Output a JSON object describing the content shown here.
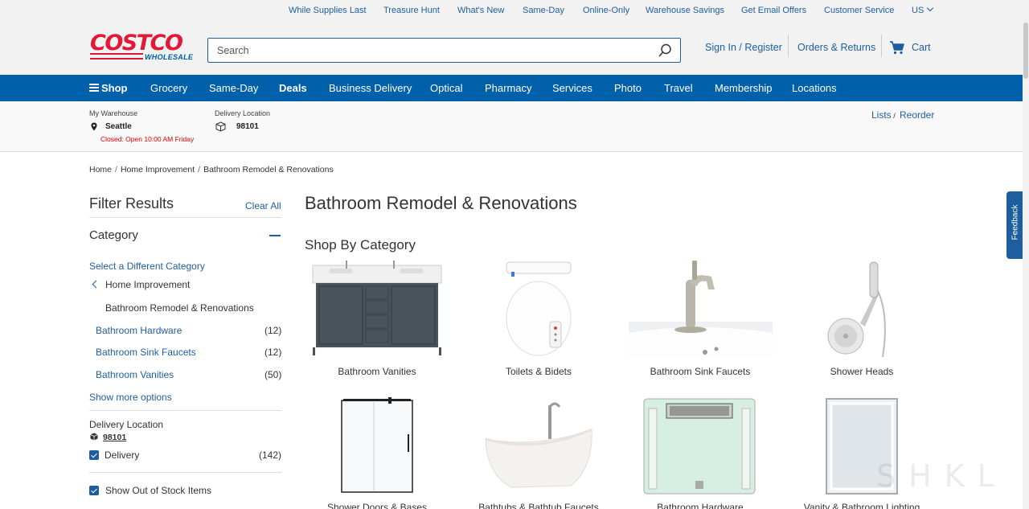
{
  "utility_bar": {
    "links": [
      "While Supplies Last",
      "Treasure Hunt",
      "What's New",
      "Same-Day",
      "Online-Only",
      "Warehouse Savings",
      "Get Email Offers",
      "Customer Service"
    ],
    "country": "US"
  },
  "header": {
    "logo_top": "COSTCO",
    "logo_bottom": "WHOLESALE",
    "search_placeholder": "Search",
    "sign_in": "Sign In / Register",
    "orders": "Orders & Returns",
    "cart": "Cart"
  },
  "nav": {
    "shop": "Shop",
    "items": [
      "Grocery",
      "Same-Day",
      "Deals",
      "Business Delivery",
      "Optical",
      "Pharmacy",
      "Services",
      "Photo",
      "Travel",
      "Membership",
      "Locations"
    ]
  },
  "location_bar": {
    "warehouse_label": "My Warehouse",
    "warehouse_name": "Seattle",
    "warehouse_status": "Closed: Open 10:00 AM Friday",
    "delivery_label": "Delivery Location",
    "delivery_zip": "98101",
    "lists": "Lists",
    "reorder": "Reorder"
  },
  "breadcrumb": [
    "Home",
    "Home Improvement",
    "Bathroom Remodel & Renovations"
  ],
  "filters": {
    "title": "Filter Results",
    "clear_all": "Clear All",
    "category_title": "Category",
    "select_different": "Select a Different Category",
    "parent": "Home Improvement",
    "current": "Bathroom Remodel & Renovations",
    "subcategories": [
      {
        "label": "Bathroom Hardware",
        "count": "(12)"
      },
      {
        "label": "Bathroom Sink Faucets",
        "count": "(12)"
      },
      {
        "label": "Bathroom Vanities",
        "count": "(50)"
      }
    ],
    "show_more": "Show more options",
    "delivery_location_label": "Delivery Location",
    "delivery_zip": "98101",
    "delivery_option": "Delivery",
    "delivery_count": "(142)",
    "show_out_of_stock": "Show Out of Stock Items"
  },
  "main": {
    "title": "Bathroom Remodel & Renovations",
    "shop_by": "Shop By Category",
    "categories": [
      "Bathroom Vanities",
      "Toilets & Bidets",
      "Bathroom Sink Faucets",
      "Shower Heads",
      "Shower Doors & Bases",
      "Bathtubs & Bathtub Faucets",
      "Bathroom Hardware",
      "Vanity & Bathroom Lighting"
    ]
  },
  "feedback": "Feedback",
  "watermark": "SHKL",
  "colors": {
    "brand_red": "#e31837",
    "brand_blue": "#005daa",
    "nav_blue": "#0060a9",
    "link_blue": "#1f5e9e"
  }
}
